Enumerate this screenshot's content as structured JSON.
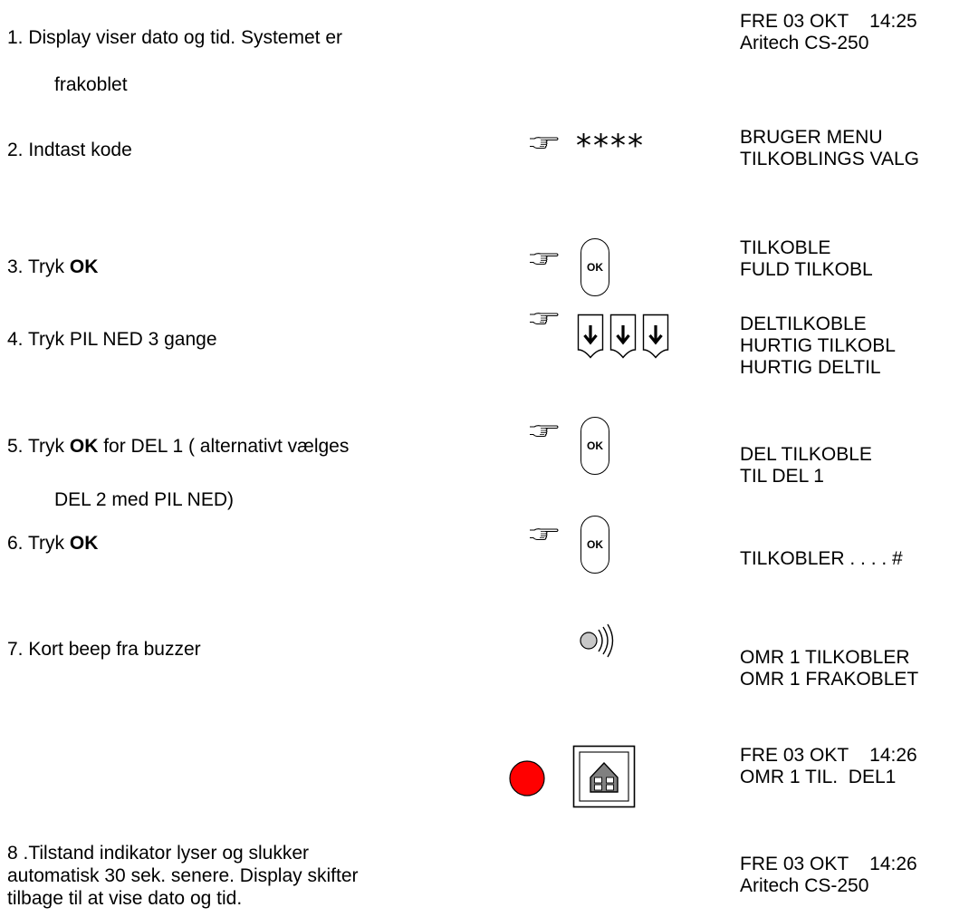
{
  "steps": {
    "s1": {
      "line1": "1.  Display viser dato og tid. Systemet er",
      "line2": "frakoblet"
    },
    "s2": {
      "text": "2. Indtast kode"
    },
    "s3": {
      "prefix": "3.  Tryk ",
      "bold": "OK"
    },
    "s4": {
      "text": "4. Tryk PIL NED 3 gange"
    },
    "s5": {
      "prefix": "5.  Tryk ",
      "bold": "OK",
      "suffix": " for DEL 1 ( alternativt vælges",
      "line2": "DEL 2 med PIL NED)"
    },
    "s6": {
      "prefix": "6.  Tryk ",
      "bold": "OK"
    },
    "s7": {
      "text": "7.  Kort  beep fra buzzer"
    },
    "s8": {
      "line1": "8 .Tilstand indikator lyser og slukker",
      "line2": "automatisk  30 sek. senere.  Display skifter",
      "line3": "tilbage til at vise dato og tid."
    }
  },
  "code_entry": "****",
  "ok_label": "OK",
  "displays": {
    "d1": [
      "FRE 03 OKT    14:25",
      "Aritech CS-250"
    ],
    "d2": [
      "BRUGER MENU",
      "TILKOBLINGS VALG"
    ],
    "d3": [
      "TILKOBLE",
      "FULD TILKOBL"
    ],
    "d4": [
      "DELTILKOBLE",
      "HURTIG TILKOBL",
      "HURTIG DELTIL"
    ],
    "d5": [
      "DEL TILKOBLE",
      "TIL DEL 1"
    ],
    "d6": [
      "TILKOBLER . . . . #"
    ],
    "d7": [
      "OMR 1 TILKOBLER",
      "OMR 1 FRAKOBLET"
    ],
    "d8": [
      "FRE 03 OKT    14:26",
      "OMR 1 TIL.  DEL1"
    ],
    "d9": [
      "FRE 03 OKT    14:26",
      "Aritech CS-250"
    ]
  },
  "icons": {
    "hand": "pointing-hand-icon",
    "arrow": "arrow-down-key-icon",
    "buzzer": "buzzer-sound-icon",
    "led": "status-led-icon",
    "house": "house-icon"
  },
  "colors": {
    "led": "#ff0000",
    "house_fill": "#808080"
  }
}
